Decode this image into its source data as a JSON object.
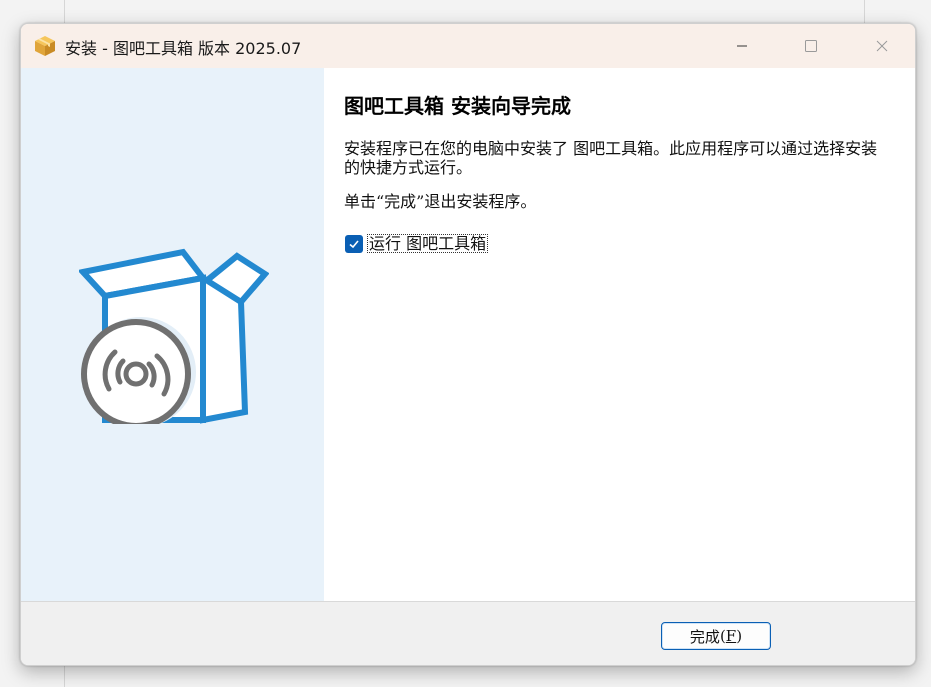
{
  "window": {
    "title": "安装 - 图吧工具箱 版本 2025.07",
    "icon": "package-box-icon"
  },
  "titlebar_buttons": {
    "minimize_icon": "minimize-icon",
    "maximize_icon": "maximize-icon",
    "close_icon": "close-icon"
  },
  "sidebar": {
    "image": "installer-box-disc-icon",
    "background": "#e8f2fa",
    "accent": "#2389d0"
  },
  "main": {
    "heading": "图吧工具箱 安装向导完成",
    "paragraph1": "安装程序已在您的电脑中安装了 图吧工具箱。此应用程序可以通过选择安装的快捷方式运行。",
    "paragraph2": "单击“完成”退出安装程序。",
    "run_checkbox": {
      "label": "运行 图吧工具箱",
      "checked": true
    }
  },
  "footer": {
    "finish_label_prefix": "完成",
    "finish_open": "(",
    "finish_accel": "F",
    "finish_close": ")"
  },
  "colors": {
    "titlebar": "#f9efe9",
    "accent_blue": "#0a5fb4",
    "footer": "#f0f0f0"
  }
}
